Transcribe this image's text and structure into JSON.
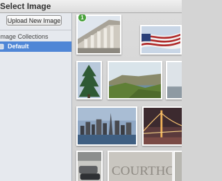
{
  "window": {
    "title": "Select Image"
  },
  "sidebar": {
    "upload_label": "Upload New Image",
    "section_title": "Image Collections",
    "collections": [
      {
        "label": "Default",
        "selected": true
      }
    ]
  },
  "gallery": {
    "thumbnails": [
      {
        "name": "courthouse-columns",
        "badge": "1"
      },
      {
        "name": "flag"
      },
      {
        "name": "pine-tree"
      },
      {
        "name": "coastline-hills"
      },
      {
        "name": "partial-thumb"
      },
      {
        "name": "city-skyline"
      },
      {
        "name": "bay-bridge"
      },
      {
        "name": "cars"
      },
      {
        "name": "courthouse-sign"
      },
      {
        "name": "partial-thumb-2"
      }
    ],
    "sign_text": "COURTHOUSE"
  },
  "colors": {
    "selection": "#4f86d6",
    "badge": "#48a23b"
  }
}
